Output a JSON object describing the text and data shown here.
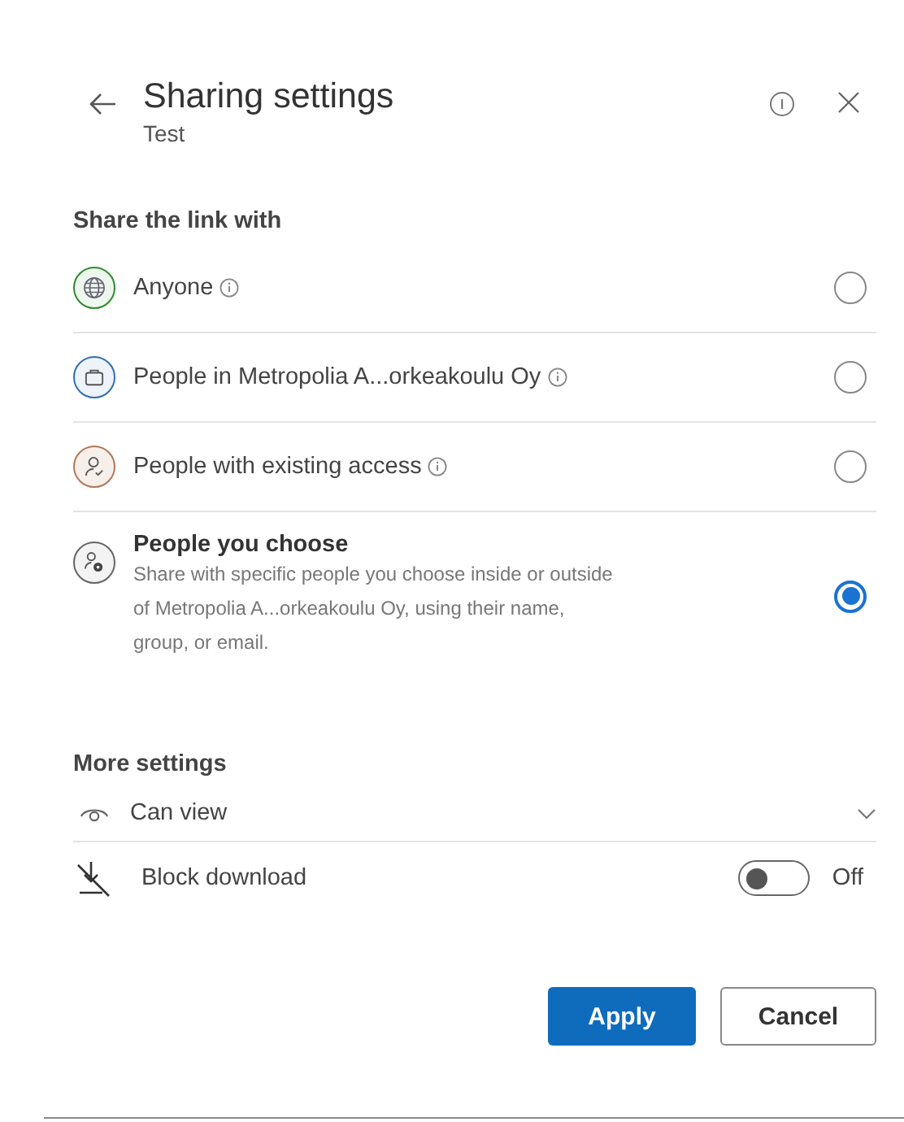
{
  "header": {
    "title": "Sharing settings",
    "subtitle": "Test"
  },
  "share_section": {
    "heading": "Share the link with",
    "options": [
      {
        "kind": "globe",
        "label": "Anyone",
        "info": true,
        "color": "#2e8b2e",
        "selected": false
      },
      {
        "kind": "briefcase",
        "label": "People in Metropolia A...orkeakoulu Oy",
        "info": true,
        "color": "#2f6fb3",
        "selected": false
      },
      {
        "kind": "person",
        "label": "People with existing access",
        "info": true,
        "color": "#b07a5a",
        "selected": false
      },
      {
        "kind": "people",
        "label": "People you choose",
        "description": "Share with specific people you choose inside or outside of Metropolia A...orkeakoulu Oy, using their name, group, or email.",
        "info": false,
        "color": "#666666",
        "selected": true
      }
    ]
  },
  "more_settings": {
    "heading": "More settings",
    "permission": "Can view",
    "block_download": {
      "label": "Block download",
      "on": false,
      "state_text": "Off"
    }
  },
  "buttons": [
    {
      "kind": "primary",
      "label": "Apply"
    },
    {
      "kind": "secondary",
      "label": "Cancel"
    }
  ]
}
